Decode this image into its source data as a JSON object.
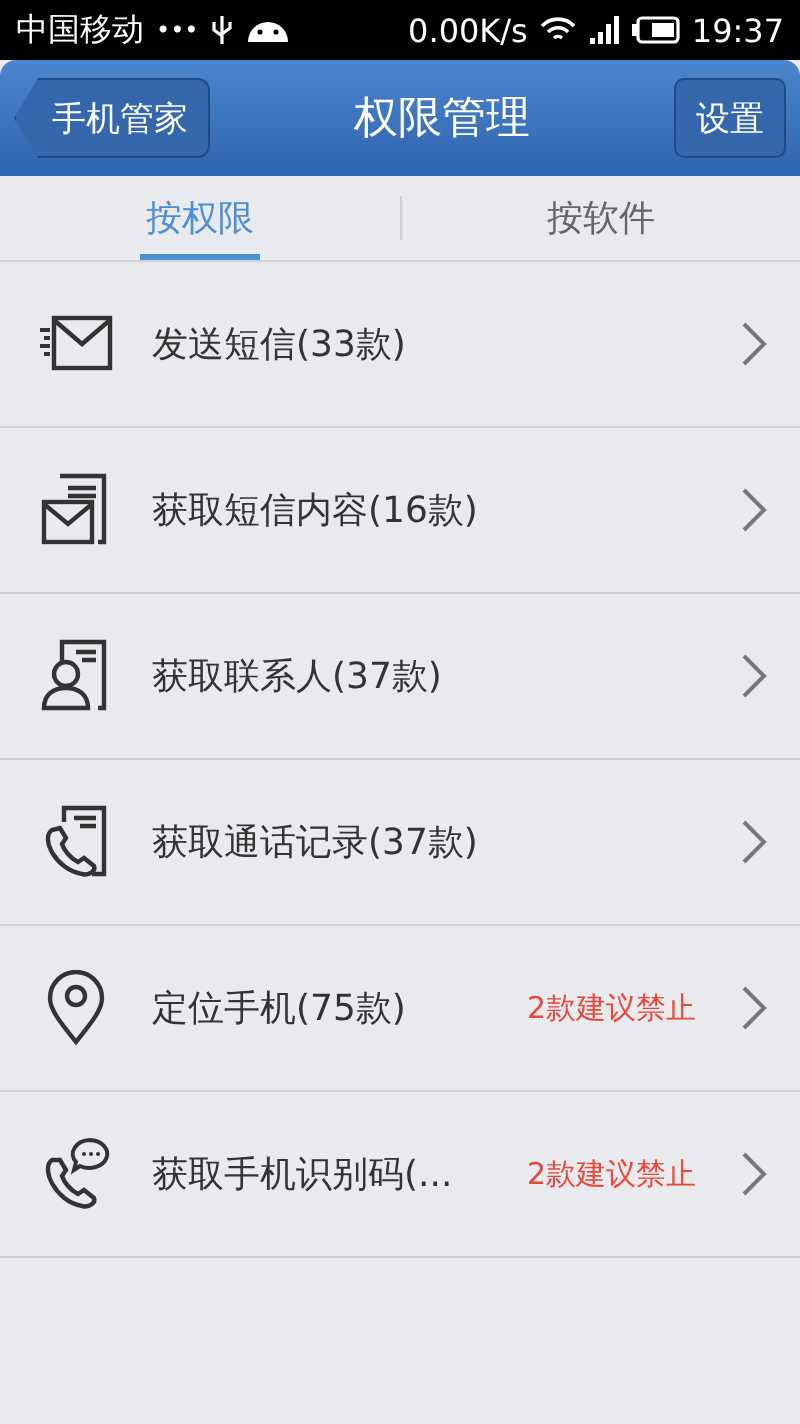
{
  "status_bar": {
    "carrier": "中国移动",
    "dots": "•••",
    "speed": "0.00K/s",
    "time": "19:37"
  },
  "header": {
    "back": "手机管家",
    "title": "权限管理",
    "action": "设置"
  },
  "tabs": [
    {
      "label": "按权限",
      "selected": true
    },
    {
      "label": "按软件",
      "selected": false
    }
  ],
  "permissions": [
    {
      "kind": "sms-send",
      "label": "发送短信(33款)"
    },
    {
      "kind": "sms-read",
      "label": "获取短信内容(16款)"
    },
    {
      "kind": "contacts",
      "label": "获取联系人(37款)"
    },
    {
      "kind": "call-log",
      "label": "获取通话记录(37款)"
    },
    {
      "kind": "location",
      "label": "定位手机(75款)",
      "warning": "2款建议禁止"
    },
    {
      "kind": "phone-id",
      "label": "获取手机识别码(...",
      "warning": "2款建议禁止"
    }
  ]
}
